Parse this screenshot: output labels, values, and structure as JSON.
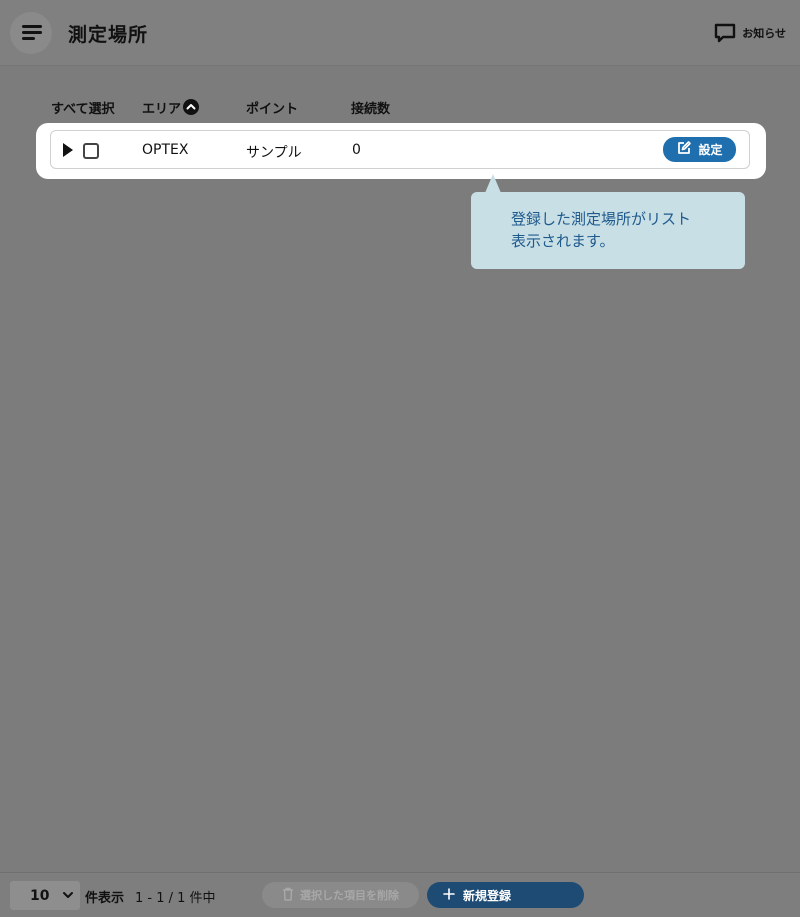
{
  "header": {
    "title": "測定場所",
    "notice_label": "お知らせ"
  },
  "table": {
    "columns": {
      "select_all": "すべて選択",
      "area": "エリア",
      "point": "ポイント",
      "connections": "接続数"
    },
    "rows": [
      {
        "area": "OPTEX",
        "point": "サンプル",
        "connections": "0",
        "setting_label": "設定"
      }
    ]
  },
  "tooltip": {
    "line1": "登録した測定場所がリスト",
    "line2": "表示されます。"
  },
  "footer": {
    "per_page_value": "10",
    "per_page_label": "件表示",
    "range_text": "1 - 1 / 1 件中",
    "delete_label": "選択した項目を削除",
    "new_label": "新規登録"
  },
  "colors": {
    "accent": "#1f6fae",
    "primary_dark": "#1e4b74",
    "tooltip_bg": "#c9dfe6",
    "tooltip_text": "#1f5a8c"
  }
}
